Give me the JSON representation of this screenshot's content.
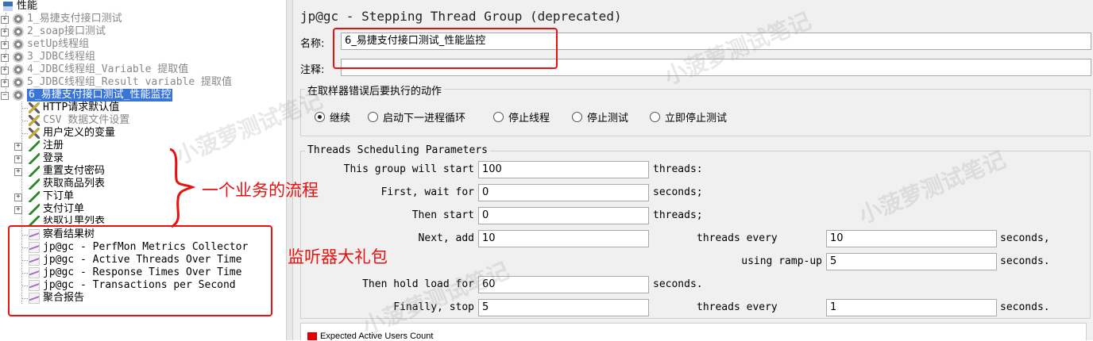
{
  "tree": {
    "root": "性能",
    "groups": [
      "1_易捷支付接口测试",
      "2_soap接口测试",
      "setUp线程组",
      "3_JDBC线程组",
      "4_JDBC线程组_Variable 提取值",
      "5_JDBC线程组_Result variable 提取值",
      "6_易捷支付接口测试_性能监控"
    ],
    "config_elements": [
      "HTTP请求默认值",
      "CSV 数据文件设置",
      "用户定义的变量"
    ],
    "samplers": [
      "注册",
      "登录",
      "重置支付密码",
      "获取商品列表",
      "下订单",
      "支付订单",
      "获取订单列表"
    ],
    "listeners": [
      "察看结果树",
      "jp@gc - PerfMon Metrics Collector",
      "jp@gc - Active Threads Over Time",
      "jp@gc - Response Times Over Time",
      "jp@gc - Transactions per Second",
      "聚合报告"
    ]
  },
  "annotations": {
    "business_flow": "一个业务的流程",
    "listeners_pack": "监听器大礼包"
  },
  "watermark": "小菠萝测试笔记",
  "panel": {
    "title": "jp@gc - Stepping Thread Group (deprecated)",
    "name_label": "名称:",
    "name_value": "6_易捷支付接口测试_性能监控",
    "comment_label": "注释:",
    "comment_value": "",
    "error_action": {
      "title": "在取样器错误后要执行的动作",
      "options": [
        "继续",
        "启动下一进程循环",
        "停止线程",
        "停止测试",
        "立即停止测试"
      ],
      "selected": "继续"
    },
    "sched": {
      "title": "Threads Scheduling Parameters",
      "start_label": "This group will start",
      "start_value": "100",
      "start_unit": "threads:",
      "wait_label": "First, wait for",
      "wait_value": "0",
      "wait_unit": "seconds;",
      "then_label": "Then start",
      "then_value": "0",
      "then_unit": "threads;",
      "next_label": "Next, add",
      "next_value": "10",
      "next_mid": "threads every",
      "next_every_value": "10",
      "next_unit": "seconds,",
      "ramp_label": "using ramp-up",
      "ramp_value": "5",
      "ramp_unit": "seconds.",
      "hold_label": "Then hold load for",
      "hold_value": "60",
      "hold_unit": "seconds.",
      "stop_label": "Finally, stop",
      "stop_value": "5",
      "stop_mid": "threads every",
      "stop_every_value": "1",
      "stop_unit": "seconds."
    },
    "legend": "Expected Active Users Count",
    "legend_color": "#e00000"
  }
}
